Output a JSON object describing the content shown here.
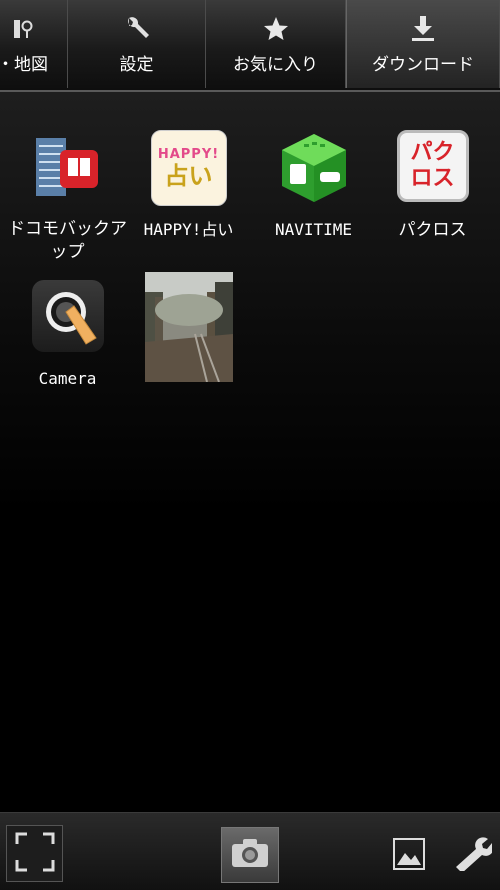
{
  "tabs": [
    {
      "label": "・地図",
      "icon": "map-pin-icon"
    },
    {
      "label": "設定",
      "icon": "wrench-icon"
    },
    {
      "label": "お気に入り",
      "icon": "star-icon"
    },
    {
      "label": "ダウンロード",
      "icon": "download-icon",
      "active": true
    }
  ],
  "apps": [
    {
      "label": "ドコモバックアップ",
      "icon": "docomo-backup-icon"
    },
    {
      "label": "HAPPY!占い",
      "icon": "happy-fortune-icon",
      "icon_text_top": "HAPPY!",
      "icon_text_bottom": "占い"
    },
    {
      "label": "NAVITIME",
      "icon": "navitime-icon"
    },
    {
      "label": "パクロス",
      "icon": "pakurosu-icon",
      "icon_text_top": "パク",
      "icon_text_bottom": "ロス"
    },
    {
      "label": "Camera",
      "icon": "camera-app-icon"
    },
    {
      "label": "",
      "icon": "photo-thumbnail"
    }
  ],
  "bottom_bar": {
    "fullscreen": "fullscreen-icon",
    "camera": "camera-icon",
    "gallery": "gallery-icon",
    "settings": "wrench-icon"
  },
  "colors": {
    "accent_green": "#3cc13c",
    "accent_red": "#d8232a"
  }
}
